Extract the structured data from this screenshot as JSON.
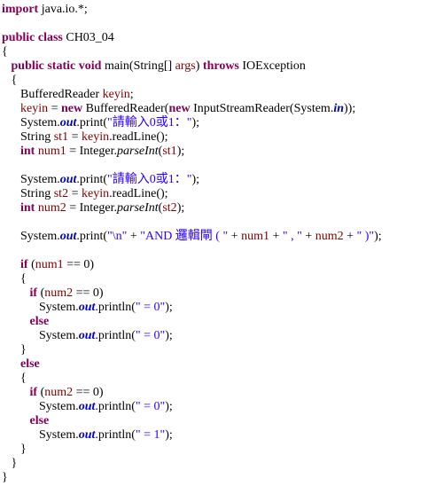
{
  "editor": {
    "language": "java",
    "colors": {
      "keyword": "#7f0055",
      "string": "#2a00ff",
      "field": "#0000c0",
      "variable": "#7f0000",
      "text": "#000000"
    },
    "lines": [
      [
        {
          "t": "kw",
          "v": "import"
        },
        {
          "t": "n",
          "v": " java.io.*;"
        }
      ],
      [],
      [
        {
          "t": "kw",
          "v": "public"
        },
        {
          "t": "n",
          "v": " "
        },
        {
          "t": "kw",
          "v": "class"
        },
        {
          "t": "n",
          "v": " CH03_04"
        }
      ],
      [
        {
          "t": "n",
          "v": "{"
        }
      ],
      [
        {
          "t": "n",
          "v": "   "
        },
        {
          "t": "kw",
          "v": "public"
        },
        {
          "t": "n",
          "v": " "
        },
        {
          "t": "kw",
          "v": "static"
        },
        {
          "t": "n",
          "v": " "
        },
        {
          "t": "kw",
          "v": "void"
        },
        {
          "t": "n",
          "v": " main(String[] "
        },
        {
          "t": "var",
          "v": "args"
        },
        {
          "t": "n",
          "v": ") "
        },
        {
          "t": "kw",
          "v": "throws"
        },
        {
          "t": "n",
          "v": " IOException"
        }
      ],
      [
        {
          "t": "n",
          "v": "   {"
        }
      ],
      [
        {
          "t": "n",
          "v": "      BufferedReader "
        },
        {
          "t": "var",
          "v": "keyin"
        },
        {
          "t": "n",
          "v": ";"
        }
      ],
      [
        {
          "t": "n",
          "v": "      "
        },
        {
          "t": "var",
          "v": "keyin"
        },
        {
          "t": "n",
          "v": " = "
        },
        {
          "t": "kw",
          "v": "new"
        },
        {
          "t": "n",
          "v": " BufferedReader("
        },
        {
          "t": "kw",
          "v": "new"
        },
        {
          "t": "n",
          "v": " InputStreamReader(System."
        },
        {
          "t": "fld",
          "v": "in"
        },
        {
          "t": "n",
          "v": "));"
        }
      ],
      [
        {
          "t": "n",
          "v": "      System."
        },
        {
          "t": "fld",
          "v": "out"
        },
        {
          "t": "n",
          "v": ".print("
        },
        {
          "t": "str",
          "v": "\"請輸入0或1：\""
        },
        {
          "t": "n",
          "v": ");"
        }
      ],
      [
        {
          "t": "n",
          "v": "      String "
        },
        {
          "t": "var",
          "v": "st1"
        },
        {
          "t": "n",
          "v": " = "
        },
        {
          "t": "var",
          "v": "keyin"
        },
        {
          "t": "n",
          "v": ".readLine();"
        }
      ],
      [
        {
          "t": "n",
          "v": "      "
        },
        {
          "t": "kw",
          "v": "int"
        },
        {
          "t": "n",
          "v": " "
        },
        {
          "t": "var",
          "v": "num1"
        },
        {
          "t": "n",
          "v": " = Integer."
        },
        {
          "t": "st",
          "v": "parseInt"
        },
        {
          "t": "n",
          "v": "("
        },
        {
          "t": "var",
          "v": "st1"
        },
        {
          "t": "n",
          "v": ");"
        }
      ],
      [],
      [
        {
          "t": "n",
          "v": "      System."
        },
        {
          "t": "fld",
          "v": "out"
        },
        {
          "t": "n",
          "v": ".print("
        },
        {
          "t": "str",
          "v": "\"請輸入0或1：\""
        },
        {
          "t": "n",
          "v": ");"
        }
      ],
      [
        {
          "t": "n",
          "v": "      String "
        },
        {
          "t": "var",
          "v": "st2"
        },
        {
          "t": "n",
          "v": " = "
        },
        {
          "t": "var",
          "v": "keyin"
        },
        {
          "t": "n",
          "v": ".readLine();"
        }
      ],
      [
        {
          "t": "n",
          "v": "      "
        },
        {
          "t": "kw",
          "v": "int"
        },
        {
          "t": "n",
          "v": " "
        },
        {
          "t": "var",
          "v": "num2"
        },
        {
          "t": "n",
          "v": " = Integer."
        },
        {
          "t": "st",
          "v": "parseInt"
        },
        {
          "t": "n",
          "v": "("
        },
        {
          "t": "var",
          "v": "st2"
        },
        {
          "t": "n",
          "v": ");"
        }
      ],
      [],
      [
        {
          "t": "n",
          "v": "      System."
        },
        {
          "t": "fld",
          "v": "out"
        },
        {
          "t": "n",
          "v": ".print("
        },
        {
          "t": "str",
          "v": "\"\\n\""
        },
        {
          "t": "n",
          "v": " + "
        },
        {
          "t": "str",
          "v": "\"AND 邏輯閘 ( \""
        },
        {
          "t": "n",
          "v": " + "
        },
        {
          "t": "var",
          "v": "num1"
        },
        {
          "t": "n",
          "v": " + "
        },
        {
          "t": "str",
          "v": "\" , \""
        },
        {
          "t": "n",
          "v": " + "
        },
        {
          "t": "var",
          "v": "num2"
        },
        {
          "t": "n",
          "v": " + "
        },
        {
          "t": "str",
          "v": "\" )\""
        },
        {
          "t": "n",
          "v": ");"
        }
      ],
      [],
      [
        {
          "t": "n",
          "v": "      "
        },
        {
          "t": "kw",
          "v": "if"
        },
        {
          "t": "n",
          "v": " ("
        },
        {
          "t": "var",
          "v": "num1"
        },
        {
          "t": "n",
          "v": " == 0)"
        }
      ],
      [
        {
          "t": "n",
          "v": "      {"
        }
      ],
      [
        {
          "t": "n",
          "v": "         "
        },
        {
          "t": "kw",
          "v": "if"
        },
        {
          "t": "n",
          "v": " ("
        },
        {
          "t": "var",
          "v": "num2"
        },
        {
          "t": "n",
          "v": " == 0)"
        }
      ],
      [
        {
          "t": "n",
          "v": "            System."
        },
        {
          "t": "fld",
          "v": "out"
        },
        {
          "t": "n",
          "v": ".println("
        },
        {
          "t": "str",
          "v": "\" = 0\""
        },
        {
          "t": "n",
          "v": ");"
        }
      ],
      [
        {
          "t": "n",
          "v": "         "
        },
        {
          "t": "kw",
          "v": "else"
        }
      ],
      [
        {
          "t": "n",
          "v": "            System."
        },
        {
          "t": "fld",
          "v": "out"
        },
        {
          "t": "n",
          "v": ".println("
        },
        {
          "t": "str",
          "v": "\" = 0\""
        },
        {
          "t": "n",
          "v": ");"
        }
      ],
      [
        {
          "t": "n",
          "v": "      }"
        }
      ],
      [
        {
          "t": "n",
          "v": "      "
        },
        {
          "t": "kw",
          "v": "else"
        }
      ],
      [
        {
          "t": "n",
          "v": "      {"
        }
      ],
      [
        {
          "t": "n",
          "v": "         "
        },
        {
          "t": "kw",
          "v": "if"
        },
        {
          "t": "n",
          "v": " ("
        },
        {
          "t": "var",
          "v": "num2"
        },
        {
          "t": "n",
          "v": " == 0)"
        }
      ],
      [
        {
          "t": "n",
          "v": "            System."
        },
        {
          "t": "fld",
          "v": "out"
        },
        {
          "t": "n",
          "v": ".println("
        },
        {
          "t": "str",
          "v": "\" = 0\""
        },
        {
          "t": "n",
          "v": ");"
        }
      ],
      [
        {
          "t": "n",
          "v": "         "
        },
        {
          "t": "kw",
          "v": "else"
        }
      ],
      [
        {
          "t": "n",
          "v": "            System."
        },
        {
          "t": "fld",
          "v": "out"
        },
        {
          "t": "n",
          "v": ".println("
        },
        {
          "t": "str",
          "v": "\" = 1\""
        },
        {
          "t": "n",
          "v": ");"
        }
      ],
      [
        {
          "t": "n",
          "v": "      }"
        }
      ],
      [
        {
          "t": "n",
          "v": "   }"
        }
      ],
      [
        {
          "t": "n",
          "v": "}"
        }
      ]
    ]
  }
}
